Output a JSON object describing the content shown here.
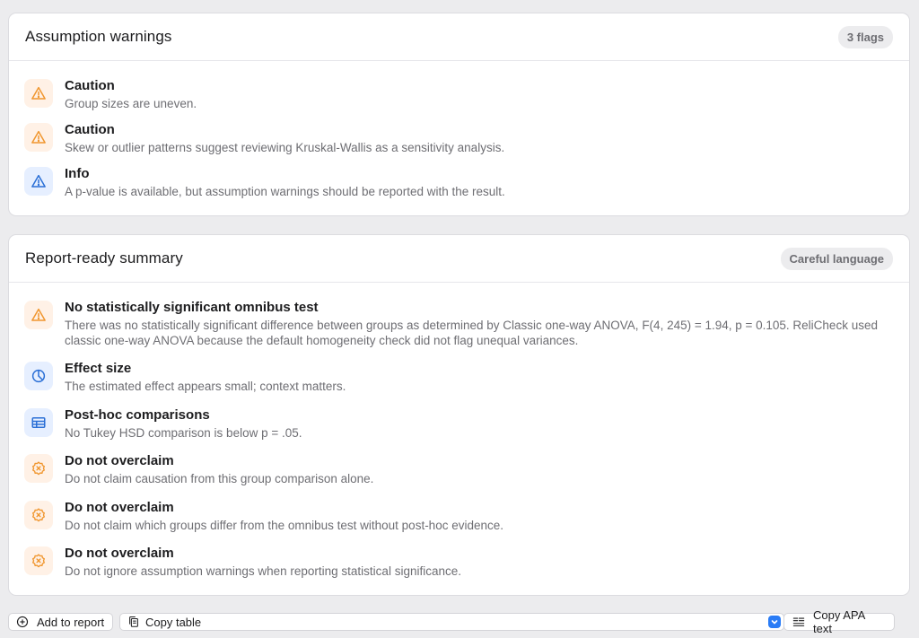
{
  "assumptions": {
    "title": "Assumption warnings",
    "badge": "3 flags",
    "items": [
      {
        "icon": "warning-icon",
        "title": "Caution",
        "desc": "Group sizes are uneven."
      },
      {
        "icon": "warning-icon",
        "title": "Caution",
        "desc": "Skew or outlier patterns suggest reviewing Kruskal-Wallis as a sensitivity analysis."
      },
      {
        "icon": "info-warning-icon",
        "title": "Info",
        "desc": "A p-value is available, but assumption warnings should be reported with the result."
      }
    ]
  },
  "summary": {
    "title": "Report-ready summary",
    "badge": "Careful language",
    "items": [
      {
        "icon": "warning-icon",
        "title": "No statistically significant omnibus test",
        "desc": "There was no statistically significant difference between groups as determined by Classic one-way ANOVA, F(4, 245) = 1.94, p = 0.105. ReliCheck used classic one-way ANOVA because the default homogeneity check did not flag unequal variances."
      },
      {
        "icon": "gauge-icon",
        "title": "Effect size",
        "desc": "The estimated effect appears small; context matters."
      },
      {
        "icon": "table-icon",
        "title": "Post-hoc comparisons",
        "desc": "No Tukey HSD comparison is below p = .05."
      },
      {
        "icon": "no-entry-badge-icon",
        "title": "Do not overclaim",
        "desc": "Do not claim causation from this group comparison alone."
      },
      {
        "icon": "no-entry-badge-icon",
        "title": "Do not overclaim",
        "desc": "Do not claim which groups differ from the omnibus test without post-hoc evidence."
      },
      {
        "icon": "no-entry-badge-icon",
        "title": "Do not overclaim",
        "desc": "Do not ignore assumption warnings when reporting statistical significance."
      }
    ]
  },
  "toolbar": {
    "add_label": "Add to report",
    "copy_table_label": "Copy table",
    "copy_apa_label": "Copy APA text"
  },
  "colors": {
    "warning": "#f0962e",
    "info": "#2a6fd6",
    "accent": "#2a7cf6"
  }
}
